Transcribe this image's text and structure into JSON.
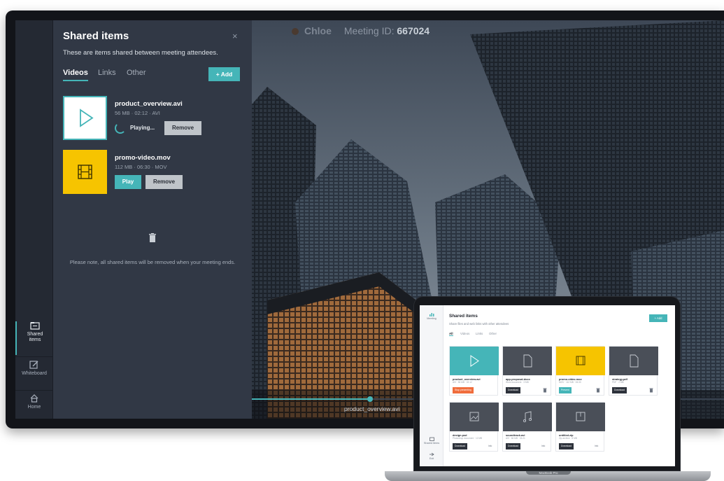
{
  "meeting": {
    "participant": "Chloe",
    "id_label": "Meeting ID:",
    "id_value": "667024"
  },
  "rail": {
    "items": [
      {
        "label": "Shared\nitems",
        "icon": "folder-icon",
        "active": true
      },
      {
        "label": "Whiteboard",
        "icon": "pencil-icon",
        "active": false
      },
      {
        "label": "Home",
        "icon": "home-icon",
        "active": false
      }
    ]
  },
  "panel": {
    "title": "Shared items",
    "close": "×",
    "subtitle": "These are items shared between meeting attendees.",
    "tabs": [
      "Videos",
      "Links",
      "Other"
    ],
    "active_tab": "Videos",
    "add_label": "+ Add",
    "items": [
      {
        "name": "product_overview.avi",
        "meta": "56 MB  ·  02:12  ·  AVI",
        "status": "Playing...",
        "remove_label": "Remove",
        "thumb_icon": "play-icon"
      },
      {
        "name": "promo-video.mov",
        "meta": "112 MB  ·  06:30  ·  MOV",
        "play_label": "Play",
        "remove_label": "Remove",
        "thumb_icon": "film-icon"
      }
    ],
    "note": "Please note, all shared items will be removed when your meeting ends."
  },
  "player": {
    "now_playing": "product_overview.avi",
    "progress": 0.25
  },
  "laptop": {
    "brand": "MacBook Pro",
    "title": "Shared items",
    "subtitle": "Share files and web links with other attendees",
    "add_label": "+ Add",
    "tabs": [
      "All",
      "Videos",
      "Links",
      "Other"
    ],
    "active_tab": "All",
    "rail": [
      {
        "label": "Meeting",
        "icon": "meeting-icon"
      },
      {
        "label": "Shared items",
        "icon": "folder-icon"
      },
      {
        "label": "Exit",
        "icon": "exit-icon"
      }
    ],
    "cards": [
      {
        "name": "product_overview.avi",
        "meta": "AVI · 56 MB · 02:12",
        "button": "Stop presenting",
        "button_style": "orange",
        "icon": "play-icon",
        "thumb": "teal"
      },
      {
        "name": "app-proposal.docx",
        "meta": "Word document · 3 MB",
        "button": "Download",
        "button_style": "dark",
        "icon": "document-icon",
        "thumb": "dark"
      },
      {
        "name": "promo-video.mov",
        "meta": "MOV · 112 MB · 06:30",
        "button": "Present",
        "button_style": "teal",
        "icon": "film-icon",
        "thumb": "yellow"
      },
      {
        "name": "strategy.pdf",
        "meta": "PDF · 2 MB",
        "button": "Download",
        "button_style": "dark",
        "icon": "document-icon",
        "thumb": "dark"
      },
      {
        "name": "design.psd",
        "meta": "Photoshop document · 12 MB",
        "button": "Download",
        "button_style": "dark",
        "icon": "image-icon",
        "thumb": "dark"
      },
      {
        "name": "soundtrack.avi",
        "meta": "AVI · 66 MB · 03:21",
        "button": "Download",
        "button_style": "dark",
        "icon": "music-icon",
        "thumb": "dark"
      },
      {
        "name": "untitled.zip",
        "meta": "Zip archive · 8 MB",
        "button": "Download",
        "button_style": "dark",
        "icon": "archive-icon",
        "thumb": "dark"
      }
    ],
    "info_label": "Info"
  },
  "colors": {
    "accent": "#45b5b8",
    "panel_bg": "#313845",
    "rail_bg": "#242933",
    "yellow": "#f6c400",
    "orange": "#f06d3c"
  }
}
